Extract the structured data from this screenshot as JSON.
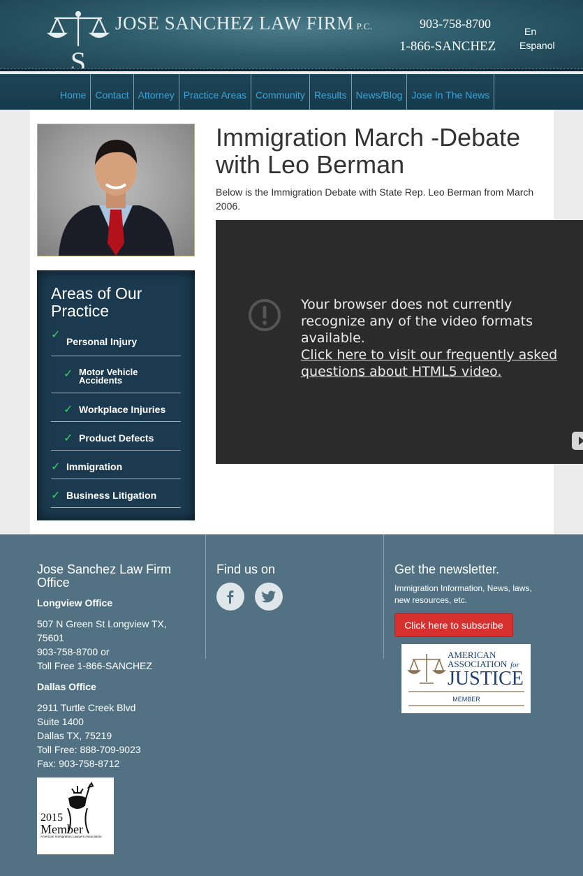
{
  "header": {
    "firm_name": "JOSE SANCHEZ LAW FIRM",
    "firm_suffix": "P.C.",
    "logo_letter": "S",
    "phone_local": "903-758-8700",
    "phone_toll_free": "1-866-SANCHEZ",
    "lang_en": "En",
    "lang_es": "Espanol"
  },
  "nav": {
    "items": [
      {
        "label": "Home"
      },
      {
        "label": "Contact"
      },
      {
        "label": "Attorney"
      },
      {
        "label": "Practice Areas"
      },
      {
        "label": "Community"
      },
      {
        "label": "Results"
      },
      {
        "label": "News/Blog"
      },
      {
        "label": "Jose In The News"
      }
    ],
    "link_color": "#3ea3d6"
  },
  "sidebar": {
    "practice_title": "Areas of Our Practice",
    "practice_items": [
      {
        "label": "Personal Injury",
        "sub": false
      },
      {
        "label": "Motor Vehicle Accidents",
        "sub": true
      },
      {
        "label": "Workplace Injuries",
        "sub": true
      },
      {
        "label": "Product Defects",
        "sub": true
      },
      {
        "label": "Immigration",
        "sub": false
      },
      {
        "label": "Business Litigation",
        "sub": false
      }
    ],
    "check_color": "#3dcf67"
  },
  "main": {
    "title": "Immigration March -Debate with Leo Berman",
    "intro": "Below is the Immigration Debate with State Rep. Leo Berman from March 2006.",
    "video_message": "Your browser does not currently recognize any of the video formats available.",
    "video_link": "Click here to visit our frequently asked questions about HTML5 video."
  },
  "footer": {
    "office_heading": "Jose Sanchez Law Firm Office",
    "longview_title": "Longview Office",
    "longview_lines": [
      "507 N Green St Longview TX,",
      "75601",
      "903-758-8700 or",
      "Toll Free 1-866-SANCHEZ"
    ],
    "dallas_title": "Dallas Office",
    "dallas_lines": [
      "2911 Turtle Creek Blvd",
      "Suite 1400",
      "Dallas TX, 75219",
      "Toll Free: 888-709-9023",
      "Fax: 903-758-8712"
    ],
    "find_us": "Find us on",
    "newsletter_heading": "Get the newsletter.",
    "newsletter_text": "Immigration Information, News, laws, new resources, etc.",
    "subscribe_label": "Click here to subscribe",
    "aaj_line1": "AMERICAN",
    "aaj_line2": "ASSOCIATION",
    "aaj_for": "for",
    "aaj_line3": "JUSTICE",
    "aaj_member": "MEMBER",
    "ailma_year": "2015",
    "ailma_member": "Member",
    "ailma_org": "American Immigration Lawyers Association"
  }
}
